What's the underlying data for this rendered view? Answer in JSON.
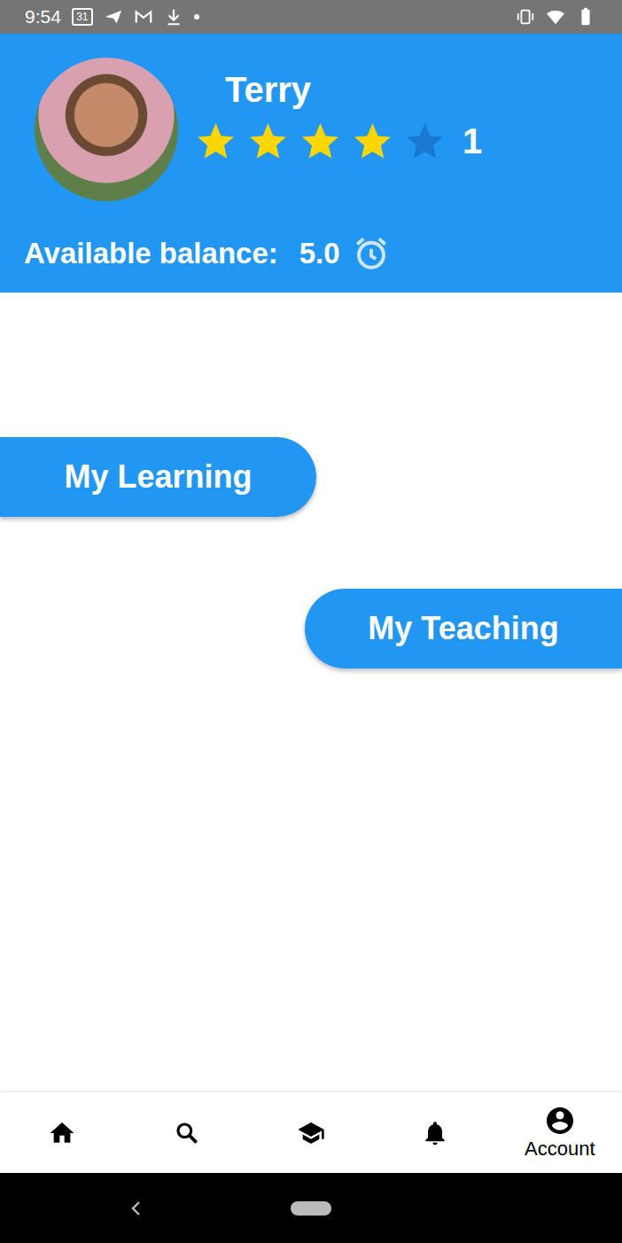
{
  "status_bar": {
    "time": "9:54",
    "calendar_day": "31"
  },
  "profile": {
    "name": "Terry",
    "stars": 4,
    "rating_count": "1"
  },
  "balance": {
    "label": "Available balance:",
    "value": "5.0"
  },
  "buttons": [
    {
      "label": "My Learning"
    },
    {
      "label": "My Teaching"
    }
  ],
  "bottom_nav": [
    {
      "selected": false
    },
    {
      "selected": false
    },
    {
      "selected": false
    },
    {
      "selected": false
    },
    {
      "label": "Account",
      "selected": true
    }
  ]
}
